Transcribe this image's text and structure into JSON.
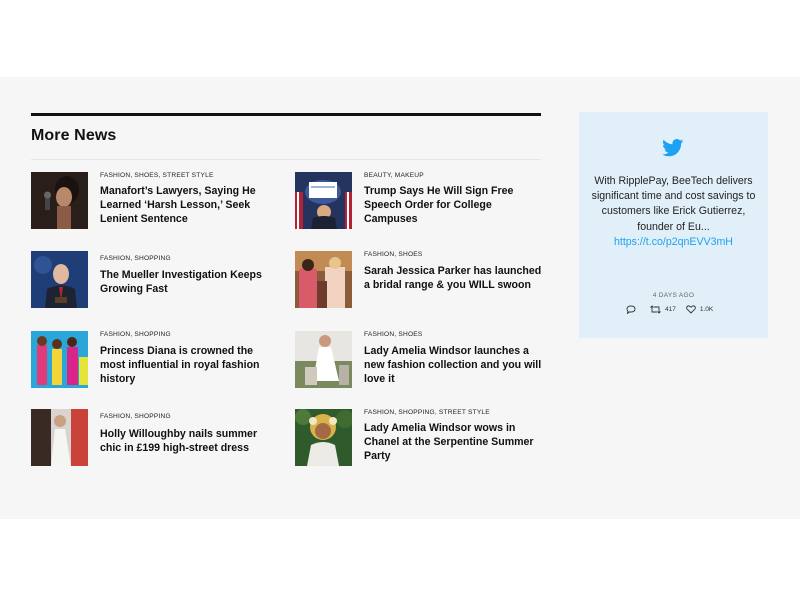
{
  "section": {
    "title": "More News"
  },
  "articles": [
    {
      "meta": "FASHION, SHOES, STREET STYLE",
      "headline": "Manafort’s Lawyers, Saying He Learned ‘Harsh Lesson,’ Seek Lenient Sentence",
      "thumb": "woman-microphone-photo"
    },
    {
      "meta": "FASHION, SHOPPING",
      "headline": "The Mueller Investigation Keeps Growing Fast",
      "thumb": "official-podium-photo"
    },
    {
      "meta": "FASHION, SHOPPING",
      "headline": "Princess Diana is crowned the most influential in royal fashion history",
      "thumb": "colorful-models-photo"
    },
    {
      "meta": "FASHION, SHOPPING",
      "headline": "Holly Willoughby nails summer chic in £199 high-street dress",
      "thumb": "white-dress-photo"
    },
    {
      "meta": "BEAUTY, MAKEUP",
      "headline": "Trump Says He Will Sign Free Speech Order for College Campuses",
      "thumb": "white-house-podium-photo"
    },
    {
      "meta": "FASHION, SHOES",
      "headline": "Sarah Jessica Parker has launched a bridal range & you WILL swoon",
      "thumb": "bridal-couple-photo"
    },
    {
      "meta": "FASHION, SHOES",
      "headline": "Lady Amelia Windsor launches a new fashion collection and you will love it",
      "thumb": "garden-fashion-photo"
    },
    {
      "meta": "FASHION, SHOPPING, STREET STYLE",
      "headline": "Lady Amelia Windsor wows in Chanel at the Serpentine Summer Party",
      "thumb": "floral-crown-photo"
    }
  ],
  "tweet": {
    "text": "With RipplePay, BeeTech delivers significant time and cost savings to customers like Erick Gutierrez, founder of Eu...",
    "link": "https://t.co/p2qnEVV3mH",
    "time": "4 DAYS AGO",
    "retweets": "417",
    "likes": "1.0K",
    "accent": "#1da1f2"
  }
}
